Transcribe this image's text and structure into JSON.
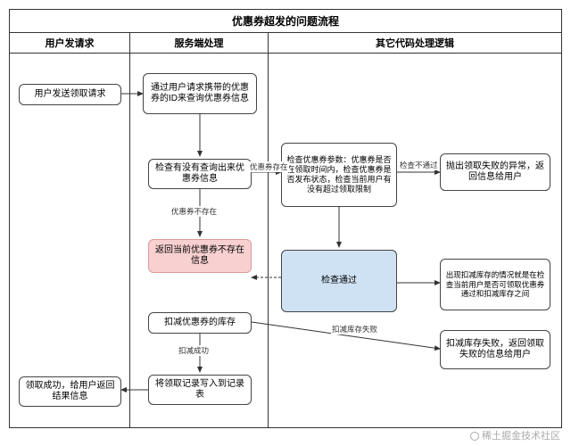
{
  "title": "优惠券超发的问题流程",
  "lanes": {
    "lane1": "用户发请求",
    "lane2": "服务端处理",
    "lane3": "其它代码处理逻辑"
  },
  "nodes": {
    "n_user_send": "用户发送领取请求",
    "n_query_info": "通过用户请求携带的优惠券的ID来查询优惠券信息",
    "n_check_query": "检查有没有查询出来优惠券信息",
    "n_not_exist": "返回当前优惠券不存在信息",
    "n_deduct": "扣减优惠券的库存",
    "n_write_log": "将领取记录写入到记录表",
    "n_success": "领取成功，给用户返回结果信息",
    "n_check_params": "检查优惠券参数：优惠券是否在领取时间内，检查优惠券是否发布状态，检查当前用户有没有超过领取限制",
    "n_check_pass": "检查通过",
    "n_throw_fail": "抛出领取失败的异常，返回信息给用户",
    "n_race_note": "出现扣减库存的情况就是在检查当前用户是否可领取优惠券通过和扣减库存之间",
    "n_deduct_fail": "扣减库存失败，返回领取失败的信息给用户"
  },
  "edges": {
    "e_exist": "优惠券存在",
    "e_not_exist": "优惠券不存在",
    "e_check_fail": "检查不通过",
    "e_deduct_ok": "扣减成功",
    "e_deduct_fail": "扣减库存失败"
  },
  "watermark": "稀土掘金技术社区"
}
